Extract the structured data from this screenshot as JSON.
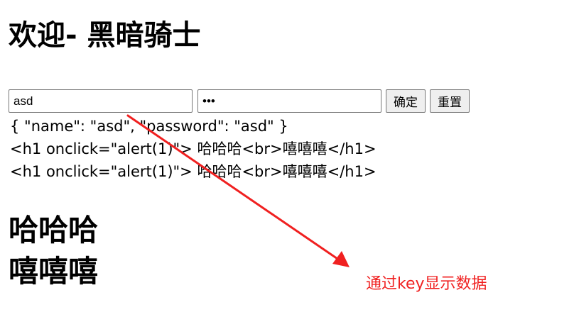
{
  "page": {
    "title": "欢迎- 黑暗骑士"
  },
  "form": {
    "username_value": "asd",
    "password_value": "asd",
    "confirm_label": "确定",
    "reset_label": "重置"
  },
  "output": {
    "json_line": "{ \"name\": \"asd\", \"password\": \"asd\" }",
    "escaped_line_1": "<h1 onclick=\"alert(1)\"> 哈哈哈<br>嘻嘻嘻</h1>",
    "escaped_line_2": "<h1 onclick=\"alert(1)\"> 哈哈哈<br>嘻嘻嘻</h1>"
  },
  "rendered_html": {
    "line_1": "哈哈哈",
    "line_2": "嘻嘻嘻"
  },
  "annotation": {
    "label": "通过key显示数据",
    "color": "#f02020",
    "icon": "red-arrow"
  }
}
